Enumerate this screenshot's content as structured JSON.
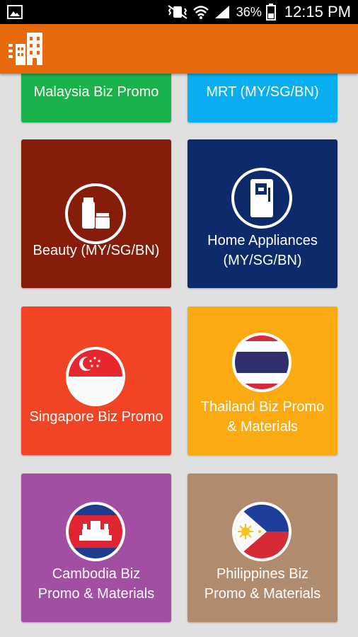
{
  "status_bar": {
    "battery": "36%",
    "time": "12:15 PM"
  },
  "app_bar": {
    "logo_icon": "buildings-menu-icon",
    "accent": "#e8680c"
  },
  "tiles": [
    {
      "label": "Malaysia Biz Promo",
      "color": "#1cb24b"
    },
    {
      "label": "MRT (MY/SG/BN)",
      "color": "#08aef0"
    },
    {
      "label": "Beauty (MY/SG/BN)",
      "color": "#861d0a",
      "icon": "cosmetics-icon"
    },
    {
      "label": "Home Appliances\n(MY/SG/BN)",
      "color": "#0d2a6a",
      "icon": "refrigerator-icon"
    },
    {
      "label": "Singapore Biz Promo",
      "color": "#f04424",
      "icon": "singapore-flag-icon"
    },
    {
      "label": "Thailand Biz Promo\n& Materials",
      "color": "#fbaa12",
      "icon": "thailand-flag-icon"
    },
    {
      "label": "Cambodia Biz\nPromo & Materials",
      "color": "#a24ea3",
      "icon": "cambodia-flag-icon"
    },
    {
      "label": "Philippines Biz\nPromo & Materials",
      "color": "#b08b6d",
      "icon": "philippines-flag-icon"
    }
  ]
}
